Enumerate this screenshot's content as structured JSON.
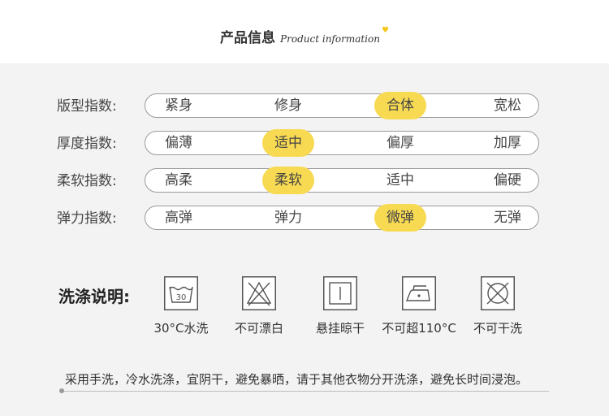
{
  "header": {
    "title_cn": "产品信息",
    "title_en": "Product information",
    "accent_color": "#f5c518"
  },
  "indices": [
    {
      "label": "版型指数:",
      "options": [
        "紧身",
        "修身",
        "合体",
        "宽松"
      ],
      "selected": 2
    },
    {
      "label": "厚度指数:",
      "options": [
        "偏薄",
        "适中",
        "偏厚",
        "加厚"
      ],
      "selected": 1
    },
    {
      "label": "柔软指数:",
      "options": [
        "高柔",
        "柔软",
        "适中",
        "偏硬"
      ],
      "selected": 1
    },
    {
      "label": "弹力指数:",
      "options": [
        "高弹",
        "弹力",
        "微弹",
        "无弹"
      ],
      "selected": 2
    }
  ],
  "care": {
    "title": "洗涤说明:",
    "items": [
      {
        "icon": "wash-30-icon",
        "temp": "30",
        "label": "30°C水洗"
      },
      {
        "icon": "no-bleach-icon",
        "label": "不可漂白"
      },
      {
        "icon": "hang-dry-icon",
        "label": "悬挂晾干"
      },
      {
        "icon": "iron-icon",
        "label": "不可超110°C"
      },
      {
        "icon": "no-dry-clean-icon",
        "label": "不可干洗"
      }
    ]
  },
  "note": "采用手洗，冷水洗涤，宜阴干，避免暴晒，请于其他衣物分开洗涤，避免长时间浸泡。",
  "colors": {
    "highlight": "#f7da52",
    "background": "#f3f3f3",
    "border": "#9a9a9a"
  }
}
